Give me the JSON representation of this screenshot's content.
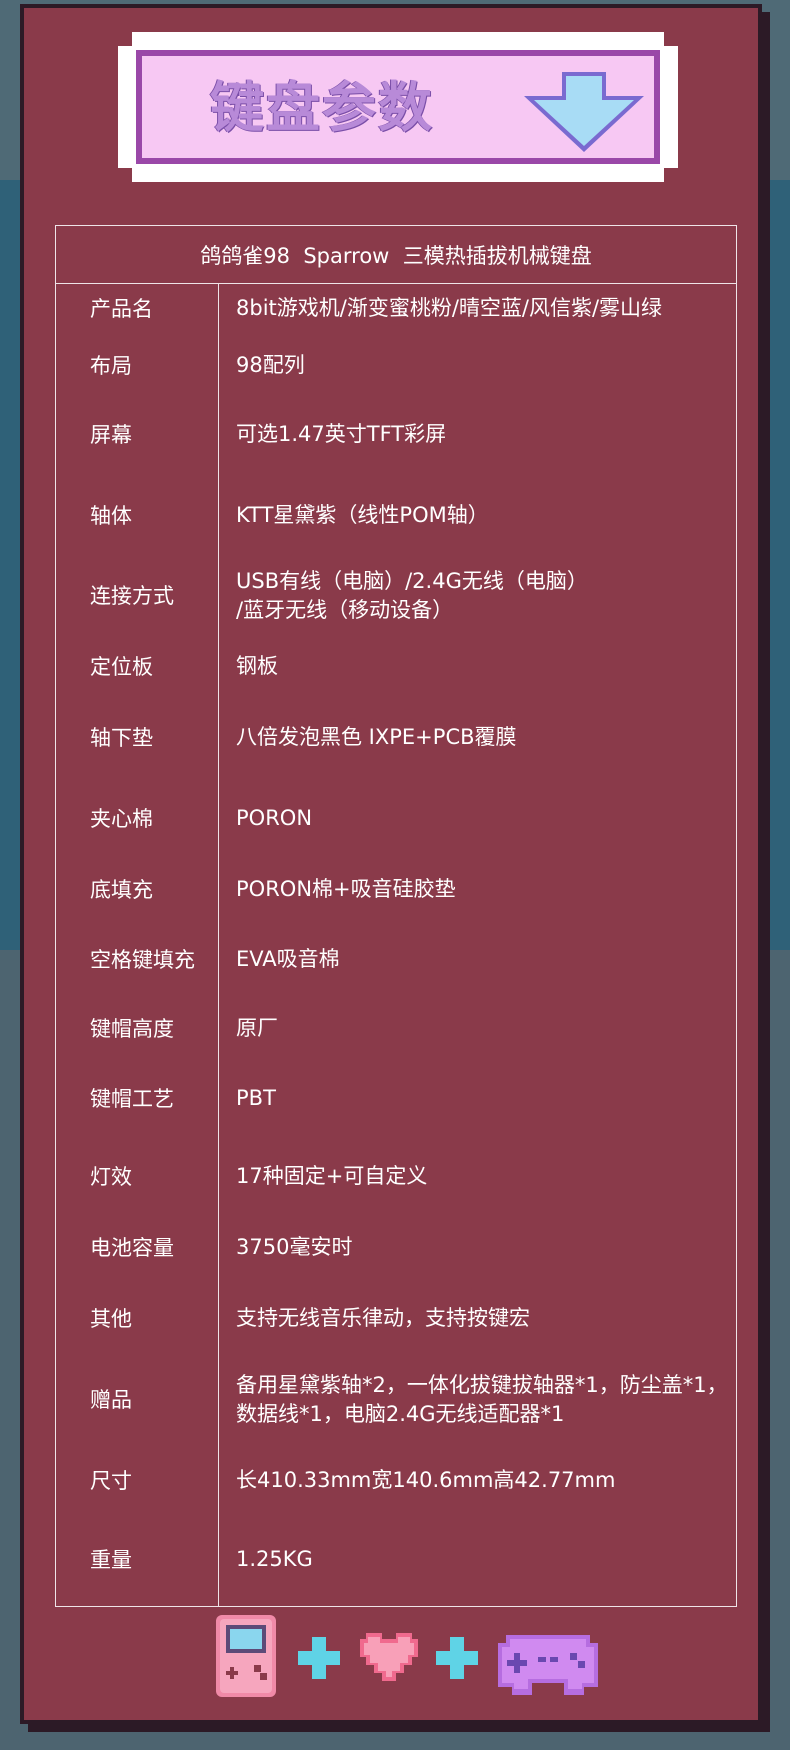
{
  "banner": {
    "title": "键盘参数",
    "arrow_icon": "down-arrow-icon"
  },
  "table": {
    "title": "鸽鸽雀98  Sparrow  三模热插拔机械键盘",
    "rows": [
      {
        "label": "产品名",
        "value": "8bit游戏机/渐变蜜桃粉/晴空蓝/风信紫/雾山绿"
      },
      {
        "label": "布局",
        "value": "98配列"
      },
      {
        "label": "屏幕",
        "value": "可选1.47英寸TFT彩屏"
      },
      {
        "label": "轴体",
        "value": "KTT星黛紫（线性POM轴）"
      },
      {
        "label": "连接方式",
        "value": "USB有线（电脑）/2.4G无线（电脑）\n/蓝牙无线（移动设备）"
      },
      {
        "label": "定位板",
        "value": "钢板"
      },
      {
        "label": "轴下垫",
        "value": "八倍发泡黑色 IXPE+PCB覆膜"
      },
      {
        "label": "夹心棉",
        "value": "PORON"
      },
      {
        "label": "底填充",
        "value": "PORON棉+吸音硅胶垫"
      },
      {
        "label": "空格键填充",
        "value": "EVA吸音棉"
      },
      {
        "label": "键帽高度",
        "value": "  原厂"
      },
      {
        "label": "键帽工艺",
        "value": "  PBT"
      },
      {
        "label": "灯效",
        "value": "17种固定+可自定义"
      },
      {
        "label": "电池容量",
        "value": "3750毫安时"
      },
      {
        "label": "其他",
        "value": "支持无线音乐律动，支持按键宏"
      },
      {
        "label": "赠品",
        "value": "备用星黛紫轴*2，一体化拔键拔轴器*1，防尘盖*1，\n数据线*1，电脑2.4G无线适配器*1"
      },
      {
        "label": "尺寸",
        "value": "长410.33mm宽140.6mm高42.77mm"
      },
      {
        "label": "重量",
        "value": "1.25KG"
      }
    ]
  },
  "footer_icons": [
    "gameboy-icon",
    "plus-icon",
    "heart-icon",
    "plus-icon",
    "gamepad-icon"
  ],
  "colors": {
    "panel": "#8a3a4a",
    "banner_face": "#f7c8f3",
    "banner_border": "#9a48a8",
    "title_text": "#b88ad8",
    "arrow": "#a8dcf5",
    "table_line": "#efe4e8"
  }
}
